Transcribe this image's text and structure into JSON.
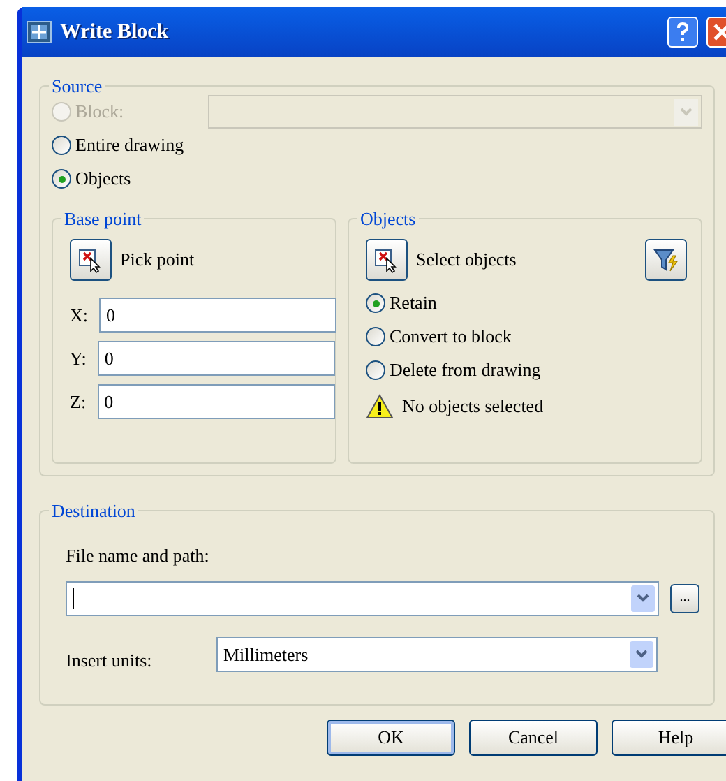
{
  "window": {
    "title": "Write Block"
  },
  "source": {
    "title": "Source",
    "options": [
      {
        "label": "Block:",
        "selected": false,
        "disabled": true
      },
      {
        "label": "Entire drawing",
        "selected": false,
        "disabled": false
      },
      {
        "label": "Objects",
        "selected": true,
        "disabled": false
      }
    ],
    "block_dropdown": {
      "disabled": true
    }
  },
  "base_point": {
    "title": "Base point",
    "pick_button": "Pick point",
    "fields": [
      {
        "label": "X:",
        "value": "0"
      },
      {
        "label": "Y:",
        "value": "0"
      },
      {
        "label": "Z:",
        "value": "0"
      }
    ]
  },
  "objects": {
    "title": "Objects",
    "select_button": "Select objects",
    "options": [
      {
        "label": "Retain",
        "selected": true
      },
      {
        "label": "Convert to block",
        "selected": false
      },
      {
        "label": "Delete from drawing",
        "selected": false
      }
    ],
    "warning": "No objects selected"
  },
  "destination": {
    "title": "Destination",
    "file_label": "File name and path:",
    "browse_button": "...",
    "units_label": "Insert units:",
    "units_value": "Millimeters"
  },
  "buttons": [
    {
      "label": "OK",
      "default": true
    },
    {
      "label": "Cancel",
      "default": false
    },
    {
      "label": "Help",
      "default": false
    }
  ]
}
